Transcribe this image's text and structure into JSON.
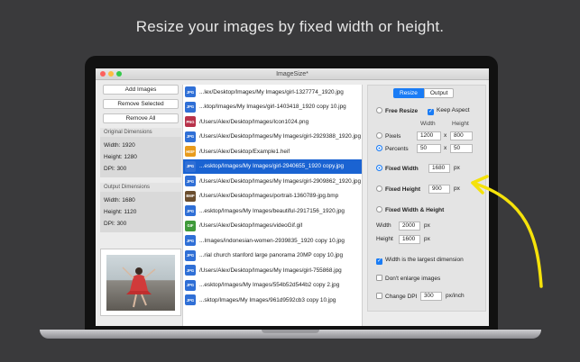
{
  "headline": "Resize your images by fixed width or height.",
  "window": {
    "title": "ImageSize*"
  },
  "left": {
    "buttons": [
      "Add Images",
      "Remove Selected",
      "Remove All"
    ],
    "original": {
      "title": "Original Dimensions",
      "width": "Width: 1920",
      "height": "Height: 1280",
      "dpi": "DPI: 300"
    },
    "output": {
      "title": "Output Dimensions",
      "width": "Width: 1680",
      "height": "Height: 1120",
      "dpi": "DPI: 300"
    }
  },
  "files": [
    {
      "type": "JPG",
      "color": "#2f6fd6",
      "path": "...lex/Desktop/Images/My Images/girl-1327774_1920.jpg"
    },
    {
      "type": "JPG",
      "color": "#2f6fd6",
      "path": "...ktop/Images/My Images/girl-1403418_1920 copy 10.jpg"
    },
    {
      "type": "PNG",
      "color": "#b8324a",
      "path": "/Users/Alex/Desktop/Images/Icon1024.png"
    },
    {
      "type": "JPG",
      "color": "#2f6fd6",
      "path": "/Users/Alex/Desktop/Images/My Images/girl-2929388_1920.jpg"
    },
    {
      "type": "HEIF",
      "color": "#e89b1c",
      "path": "/Users/Alex/Desktop/Example1.heif"
    },
    {
      "type": "JPG",
      "color": "#2f6fd6",
      "path": "...esktop/Images/My Images/girl-2940655_1920 copy.jpg",
      "selected": true
    },
    {
      "type": "JPG",
      "color": "#2f6fd6",
      "path": "/Users/Alex/Desktop/Images/My Images/girl-2909862_1920.jpg"
    },
    {
      "type": "BMP",
      "color": "#6b4e2e",
      "path": "/Users/Alex/Desktop/Images/portrait-1360789-jpg.bmp"
    },
    {
      "type": "JPG",
      "color": "#2f6fd6",
      "path": "...esktop/Images/My Images/beautiful-2917156_1920.jpg"
    },
    {
      "type": "GIF",
      "color": "#3f9a3a",
      "path": "/Users/Alex/Desktop/Images/videoGif.gif"
    },
    {
      "type": "JPG",
      "color": "#2f6fd6",
      "path": "...Images/indonesian-women-2939835_1920 copy 10.jpg"
    },
    {
      "type": "JPG",
      "color": "#2f6fd6",
      "path": "...rial church stanford large panorama 20MP copy 10.jpg"
    },
    {
      "type": "JPG",
      "color": "#2f6fd6",
      "path": "/Users/Alex/Desktop/Images/My Images/girl-755868.jpg"
    },
    {
      "type": "JPG",
      "color": "#2f6fd6",
      "path": "...esktop/Images/My Images/554b52d544b2 copy 2.jpg"
    },
    {
      "type": "JPG",
      "color": "#2f6fd6",
      "path": "...sktop/Images/My Images/961d9592cb3 copy 10.jpg"
    }
  ],
  "right": {
    "tabs": [
      "Resize",
      "Output"
    ],
    "free_resize": "Free Resize",
    "keep_aspect": "Keep Aspect",
    "width_header": "Width",
    "height_header": "Height",
    "pixels": "Pixels",
    "pixels_w": "1200",
    "pixels_h": "800",
    "percents": "Percents",
    "percents_w": "50",
    "percents_h": "50",
    "times": "x",
    "fixed_width": "Fixed Width",
    "fixed_width_val": "1680",
    "fixed_height": "Fixed Height",
    "fixed_height_val": "900",
    "px": "px",
    "fixed_wh": "Fixed Width & Height",
    "width_label": "Width",
    "width_val": "2000",
    "height_label": "Height",
    "height_val": "1600",
    "largest": "Width is the largest dimension",
    "dont_enlarge": "Don't enlarge images",
    "change_dpi": "Change DPI",
    "dpi_val": "300",
    "px_inch": "px/inch"
  },
  "colors": {
    "accent": "#1a7cf5",
    "selection": "#1a63d2",
    "arrow": "#f5e20a"
  }
}
